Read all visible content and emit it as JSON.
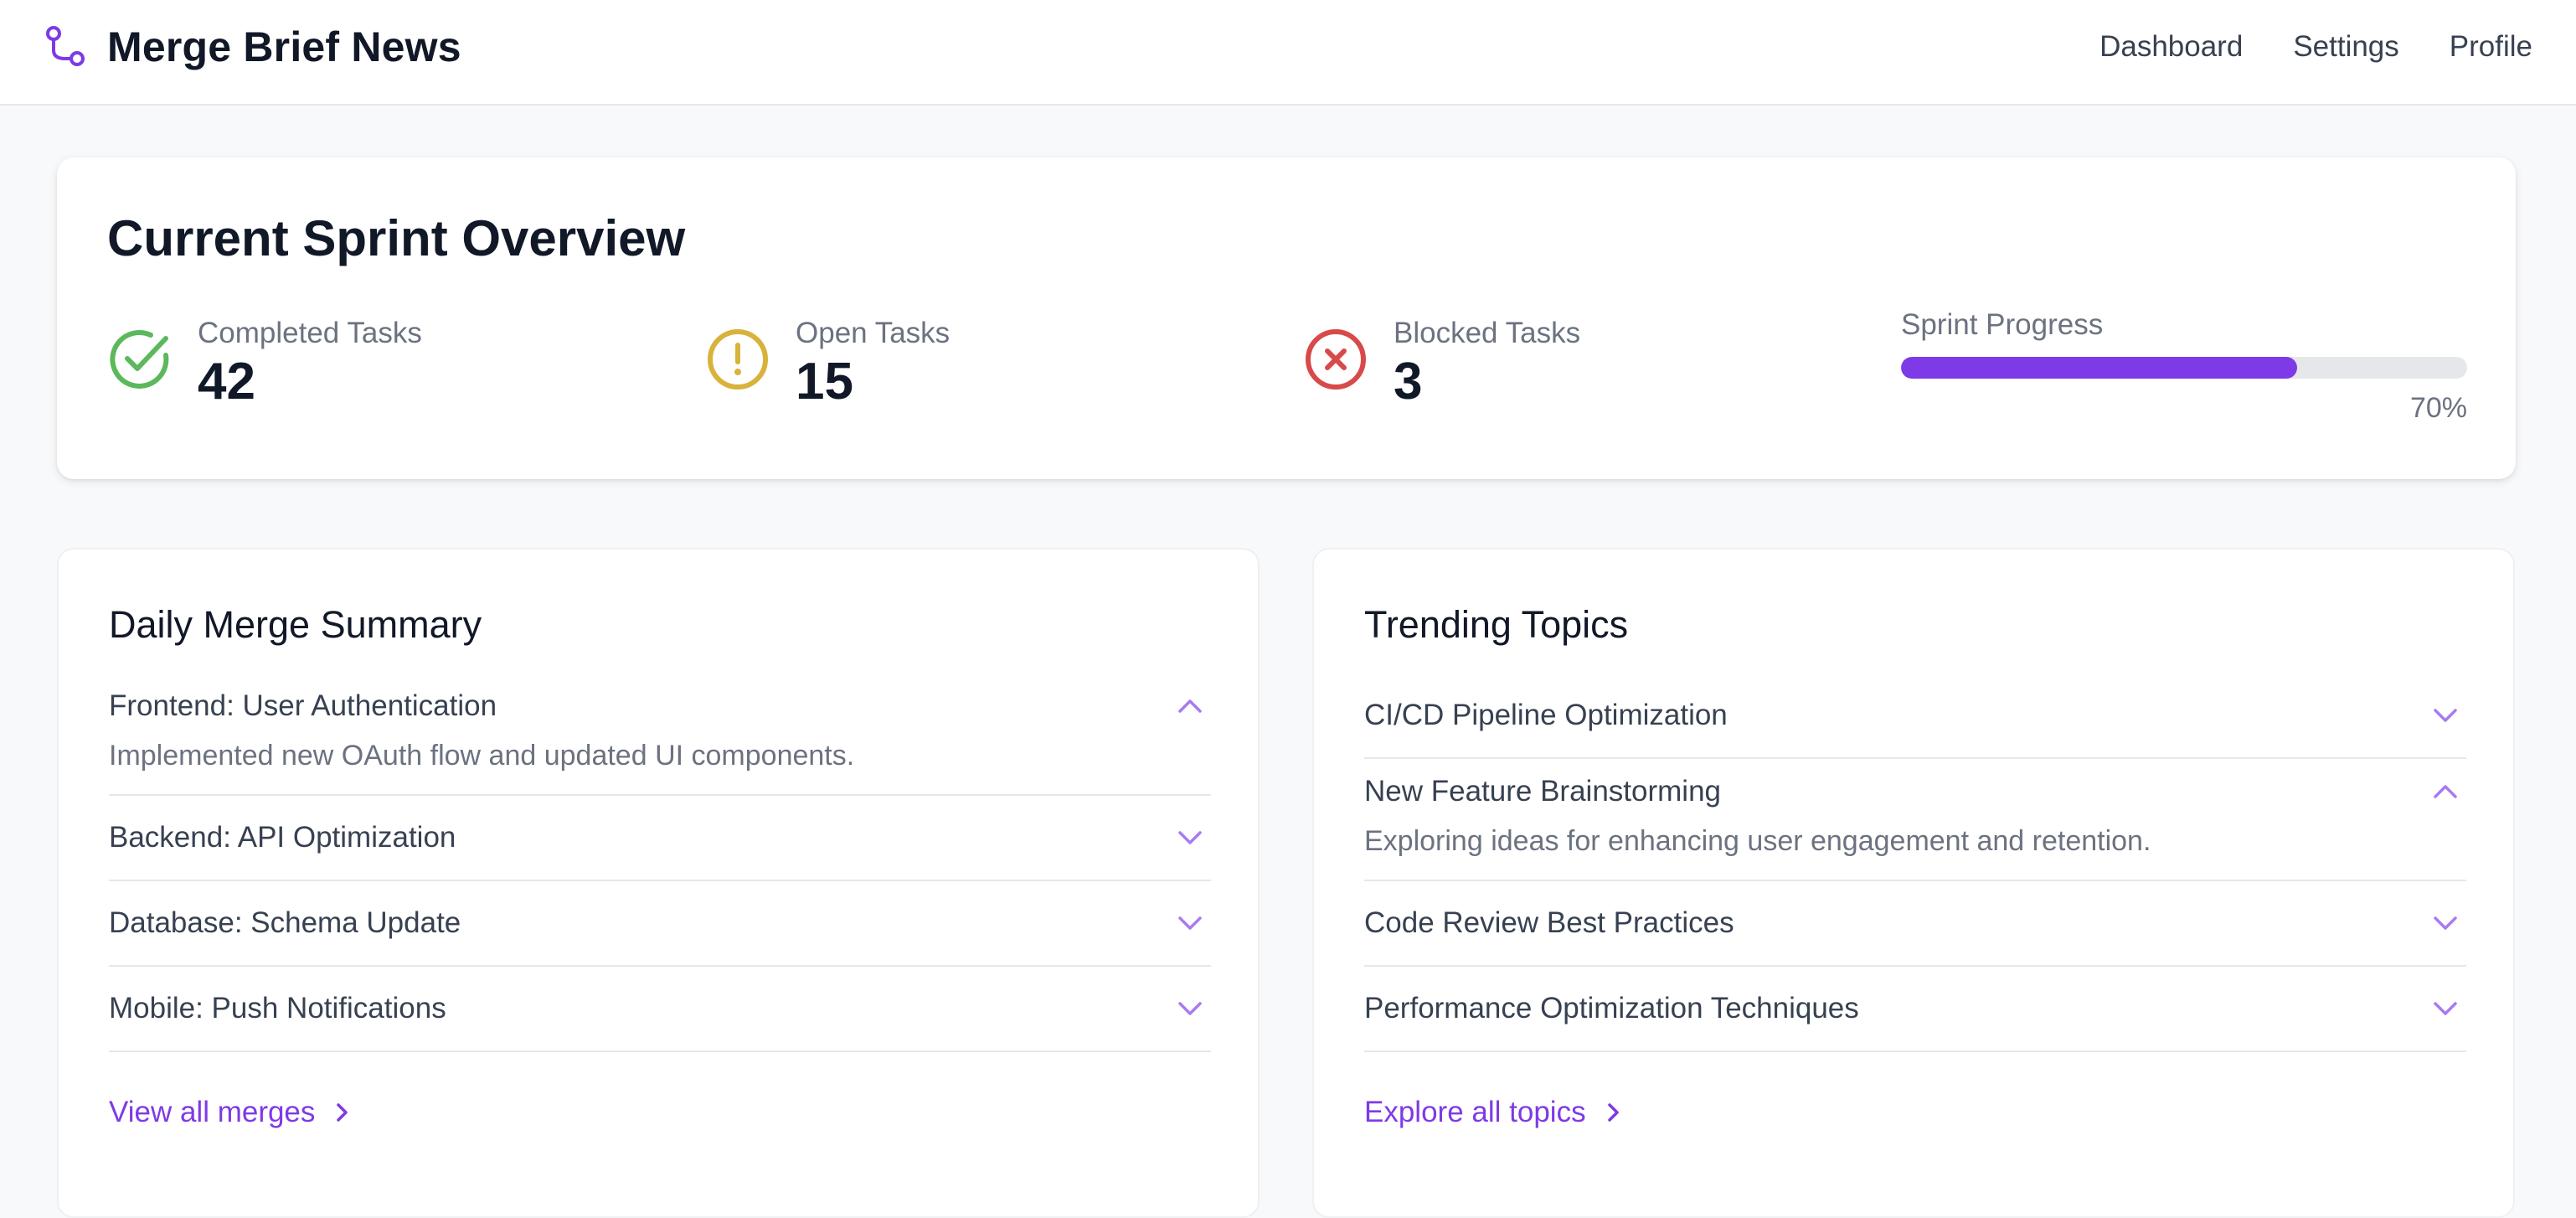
{
  "header": {
    "brand_icon": "git-merge-icon",
    "title": "Merge Brief News",
    "nav": [
      {
        "label": "Dashboard"
      },
      {
        "label": "Settings"
      },
      {
        "label": "Profile"
      }
    ]
  },
  "sprint": {
    "title": "Current Sprint Overview",
    "stats": [
      {
        "label": "Completed Tasks",
        "value": "42",
        "icon": "check-circle-icon",
        "color": "#5cb85c"
      },
      {
        "label": "Open Tasks",
        "value": "15",
        "icon": "alert-circle-icon",
        "color": "#d9b23a"
      },
      {
        "label": "Blocked Tasks",
        "value": "3",
        "icon": "x-circle-icon",
        "color": "#d84a4a"
      }
    ],
    "progress": {
      "label": "Sprint Progress",
      "value_text": "70%",
      "fraction": 0.7,
      "color": "#7e3ae6"
    }
  },
  "daily_summary": {
    "title": "Daily Merge Summary",
    "items": [
      {
        "title": "Frontend: User Authentication",
        "body": "Implemented new OAuth flow and updated UI components.",
        "open": true
      },
      {
        "title": "Backend: API Optimization",
        "open": false
      },
      {
        "title": "Database: Schema Update",
        "open": false
      },
      {
        "title": "Mobile: Push Notifications",
        "open": false
      }
    ],
    "link": "View all merges"
  },
  "trending": {
    "title": "Trending Topics",
    "items": [
      {
        "title": "CI/CD Pipeline Optimization",
        "open": false
      },
      {
        "title": "New Feature Brainstorming",
        "body": "Exploring ideas for enhancing user engagement and retention.",
        "open": true
      },
      {
        "title": "Code Review Best Practices",
        "open": false
      },
      {
        "title": "Performance Optimization Techniques",
        "open": false
      }
    ],
    "link": "Explore all topics"
  },
  "colors": {
    "accent": "#7e3ae6",
    "chevron": "#a97af0"
  }
}
